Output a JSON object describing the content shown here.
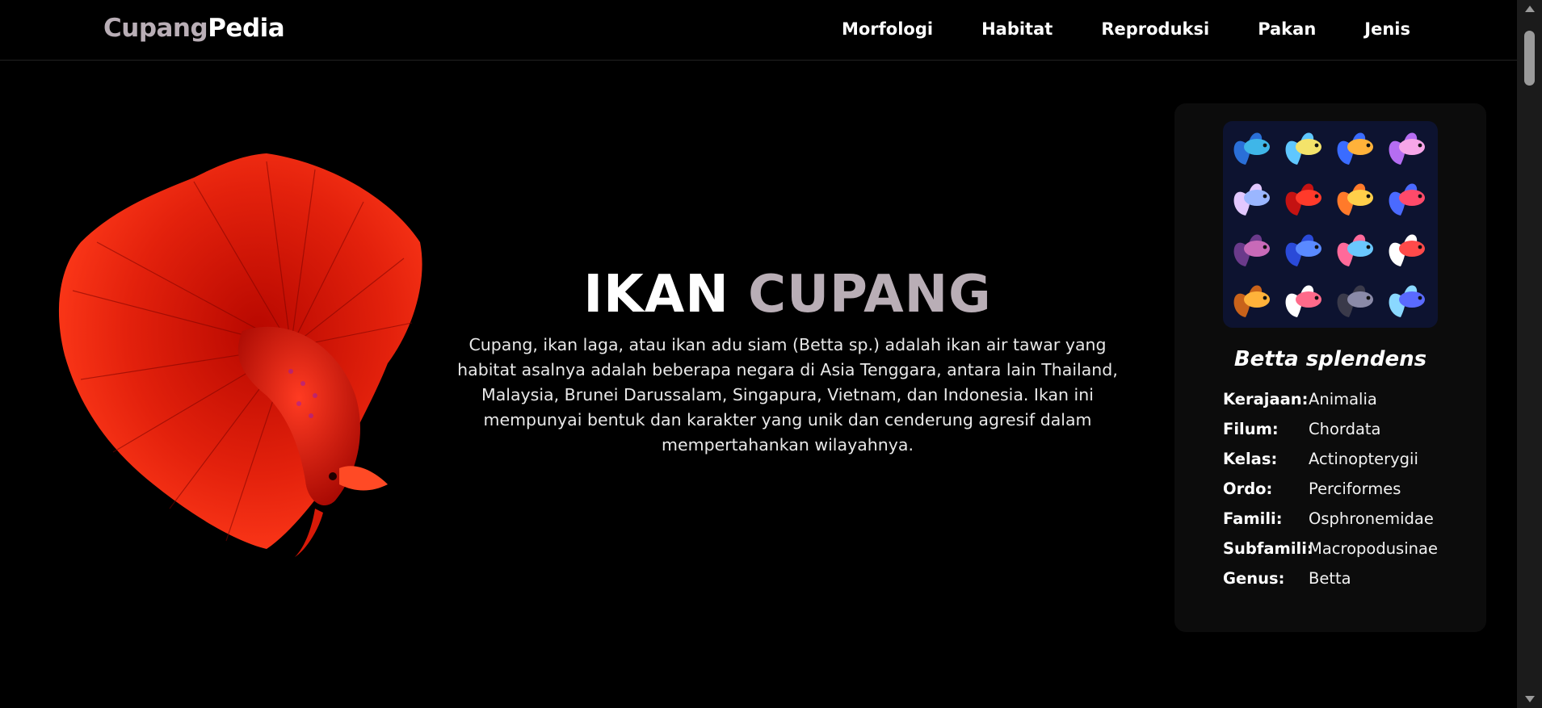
{
  "brand": {
    "part1": "Cupang",
    "part2": "Pedia"
  },
  "nav": {
    "items": [
      "Morfologi",
      "Habitat",
      "Reproduksi",
      "Pakan",
      "Jenis"
    ]
  },
  "hero": {
    "title_part1": "IKAN",
    "title_part2": "CUPANG",
    "description": "Cupang, ikan laga, atau ikan adu siam (Betta sp.) adalah ikan air tawar yang habitat asalnya adalah beberapa negara di Asia Tenggara, antara lain Thailand, Malaysia, Brunei Darussalam, Singapura, Vietnam, dan Indonesia. Ikan ini mempunyai bentuk dan karakter yang unik dan cenderung agresif dalam mempertahankan wilayahnya."
  },
  "taxonomy": {
    "species": "Betta splendens",
    "rows": [
      {
        "key": "Kerajaan:",
        "value": "Animalia"
      },
      {
        "key": "Filum:",
        "value": "Chordata"
      },
      {
        "key": "Kelas:",
        "value": "Actinopterygii"
      },
      {
        "key": "Ordo:",
        "value": "Perciformes"
      },
      {
        "key": "Famili:",
        "value": "Osphronemidae"
      },
      {
        "key": "Subfamili:",
        "value": "Macropodusinae"
      },
      {
        "key": "Genus:",
        "value": "Betta"
      }
    ]
  },
  "colors": {
    "accent": "#b9aeb6",
    "background": "#000000",
    "card": "#0c0c0c",
    "fish_red": "#e01a0a"
  },
  "icons": {
    "scroll_up": "triangle-up-icon",
    "scroll_down": "triangle-down-icon"
  }
}
